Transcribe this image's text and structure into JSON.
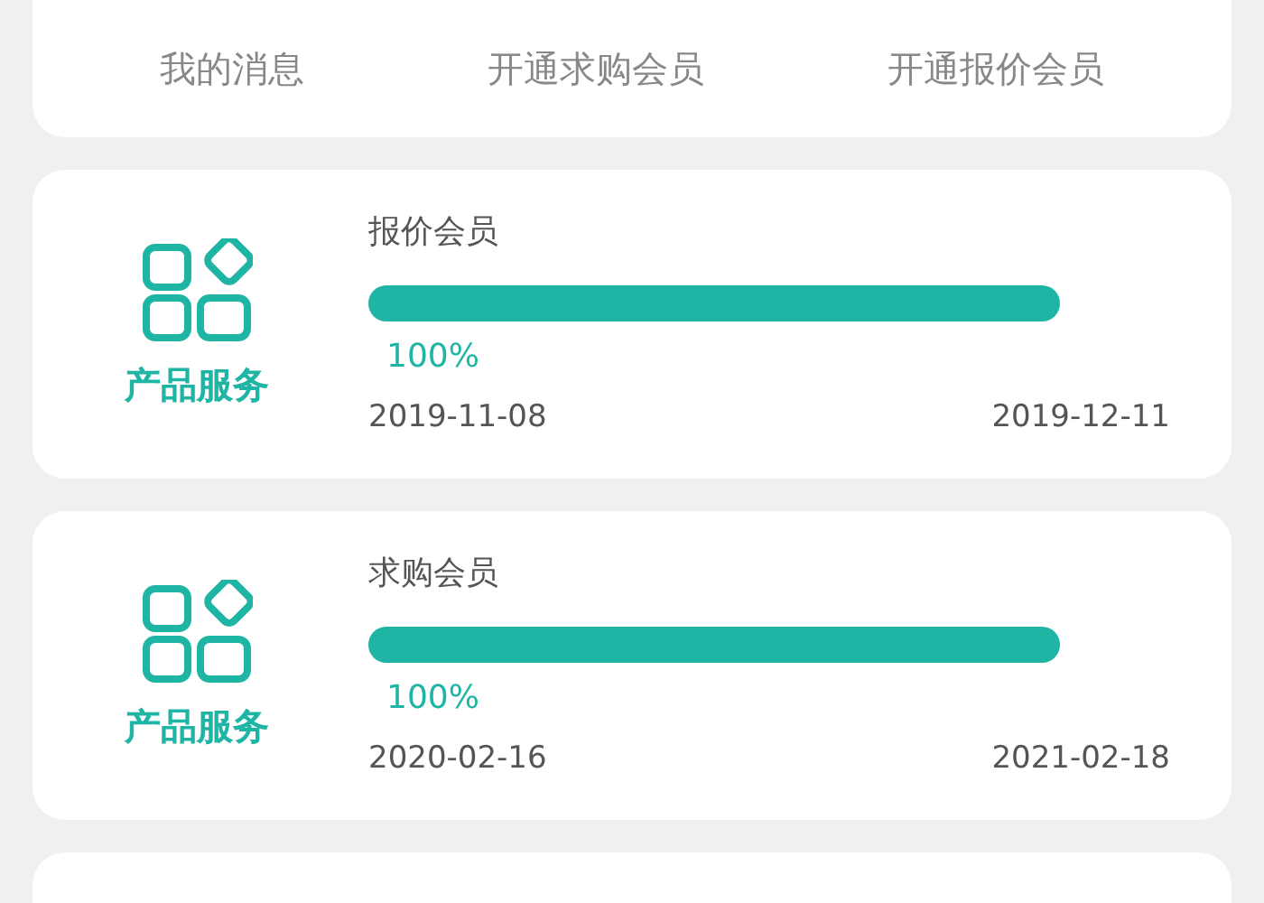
{
  "tabs": [
    {
      "label": "我的消息"
    },
    {
      "label": "开通求购会员"
    },
    {
      "label": "开通报价会员"
    }
  ],
  "memberships": [
    {
      "icon_label": "产品服务",
      "title": "报价会员",
      "level": 1,
      "percent": "100%",
      "start_date": "2019-11-08",
      "end_date": "2019-12-11"
    },
    {
      "icon_label": "产品服务",
      "title": "求购会员",
      "level": 1,
      "percent": "100%",
      "start_date": "2020-02-16",
      "end_date": "2021-02-18"
    }
  ]
}
